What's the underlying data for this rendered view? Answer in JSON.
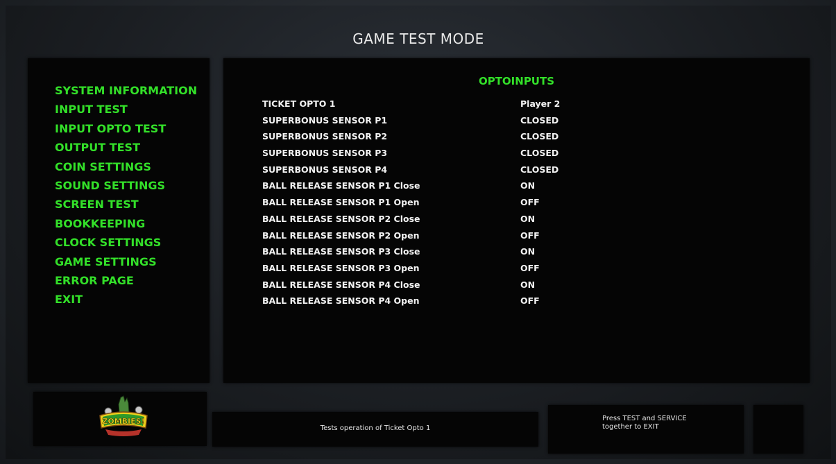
{
  "header": {
    "title": "GAME TEST MODE"
  },
  "menu": {
    "items": [
      "SYSTEM INFORMATION",
      "INPUT TEST",
      "INPUT OPTO TEST",
      "OUTPUT TEST",
      "COIN SETTINGS",
      "SOUND SETTINGS",
      "SCREEN TEST",
      "BOOKKEEPING",
      "CLOCK SETTINGS",
      "GAME SETTINGS",
      "ERROR PAGE",
      "EXIT"
    ]
  },
  "opto": {
    "heading": "OPTOINPUTS",
    "rows": [
      {
        "label": "TICKET OPTO 1",
        "value": "Player 2"
      },
      {
        "label": "SUPERBONUS SENSOR P1",
        "value": "CLOSED"
      },
      {
        "label": "SUPERBONUS SENSOR P2",
        "value": "CLOSED"
      },
      {
        "label": "SUPERBONUS SENSOR P3",
        "value": "CLOSED"
      },
      {
        "label": "SUPERBONUS SENSOR P4",
        "value": "CLOSED"
      },
      {
        "label": "BALL RELEASE SENSOR P1 Close",
        "value": "ON"
      },
      {
        "label": "BALL RELEASE SENSOR P1 Open",
        "value": "OFF"
      },
      {
        "label": "BALL RELEASE SENSOR P2 Close",
        "value": "ON"
      },
      {
        "label": "BALL RELEASE SENSOR P2 Open",
        "value": "OFF"
      },
      {
        "label": "BALL RELEASE SENSOR P3 Close",
        "value": "ON"
      },
      {
        "label": "BALL RELEASE SENSOR P3 Open",
        "value": "OFF"
      },
      {
        "label": "BALL RELEASE SENSOR P4 Close",
        "value": "ON"
      },
      {
        "label": "BALL RELEASE SENSOR P4 Open",
        "value": "OFF"
      }
    ]
  },
  "footer": {
    "description": "Tests operation of Ticket Opto 1",
    "exit_hint": "Press TEST and SERVICE\ntogether to EXIT",
    "logo_text": "ZOMBIES!"
  },
  "colors": {
    "accent": "#33e029",
    "panel": "#050505",
    "text": "#f2f2f2"
  }
}
